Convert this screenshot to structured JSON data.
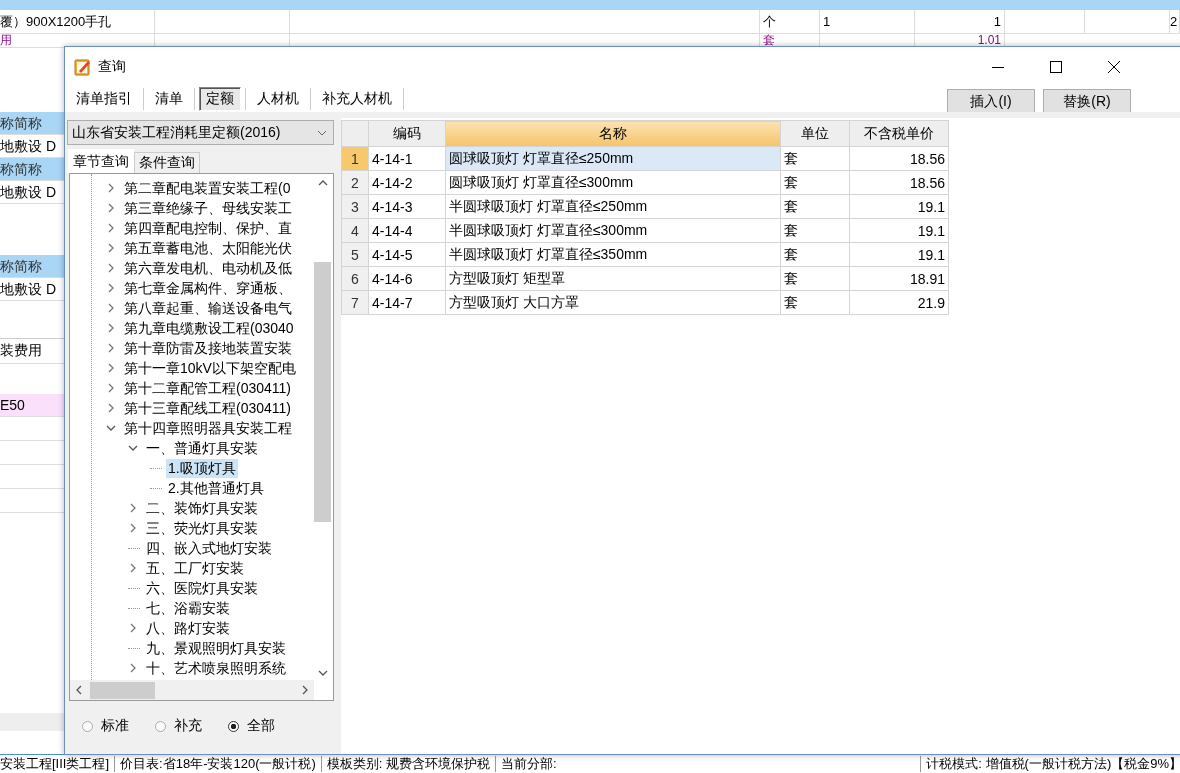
{
  "background": {
    "row_1": {
      "name": "覆）900X1200手孔",
      "unit": "个",
      "qty": "1",
      "value": "1",
      "column_9": "2"
    },
    "row_2": {
      "name": "用",
      "unit": "套",
      "value": "1.01"
    },
    "left_cells": [
      {
        "text": "称简称",
        "kind": "header"
      },
      {
        "text": "地敷设 D",
        "kind": "cell"
      },
      {
        "text": "称简称",
        "kind": "header"
      },
      {
        "text": "地敷设 D",
        "kind": "cell"
      },
      {
        "text": "称简称",
        "kind": "header"
      },
      {
        "text": "地敷设 D",
        "kind": "cell"
      },
      {
        "text": "装费用",
        "kind": "tab"
      },
      {
        "text": "E50",
        "kind": "highlight"
      }
    ]
  },
  "dialog": {
    "title": "查询",
    "tabs": [
      {
        "label": "清单指引",
        "selected": false
      },
      {
        "label": "清单",
        "selected": false
      },
      {
        "label": "定额",
        "selected": true
      },
      {
        "label": "人材机",
        "selected": false
      },
      {
        "label": "补充人材机",
        "selected": false
      }
    ],
    "buttons": [
      "插入(I)",
      "替换(R)"
    ],
    "library": "山东省安装工程消耗里定额(2016)",
    "search_tabs": [
      {
        "label": "章节查询",
        "selected": true
      },
      {
        "label": "条件查询",
        "selected": false
      }
    ],
    "tree": [
      {
        "label": "第二章配电装置安装工程(0",
        "expandable": true,
        "expanded": false,
        "selected": false
      },
      {
        "label": "第三章绝缘子、母线安装工",
        "expandable": true,
        "expanded": false,
        "selected": false
      },
      {
        "label": "第四章配电控制、保护、直",
        "expandable": true,
        "expanded": false,
        "selected": false
      },
      {
        "label": "第五章蓄电池、太阳能光伏",
        "expandable": true,
        "expanded": false,
        "selected": false
      },
      {
        "label": "第六章发电机、电动机及低",
        "expandable": true,
        "expanded": false,
        "selected": false
      },
      {
        "label": "第七章金属构件、穿通板、",
        "expandable": true,
        "expanded": false,
        "selected": false
      },
      {
        "label": "第八章起重、输送设备电气",
        "expandable": true,
        "expanded": false,
        "selected": false
      },
      {
        "label": "第九章电缆敷设工程(03040",
        "expandable": true,
        "expanded": false,
        "selected": false
      },
      {
        "label": "第十章防雷及接地装置安装",
        "expandable": true,
        "expanded": false,
        "selected": false
      },
      {
        "label": "第十一章10kV以下架空配电",
        "expandable": true,
        "expanded": false,
        "selected": false
      },
      {
        "label": "第十二章配管工程(030411)",
        "expandable": true,
        "expanded": false,
        "selected": false
      },
      {
        "label": "第十三章配线工程(030411)",
        "expandable": true,
        "expanded": false,
        "selected": false
      },
      {
        "label": "第十四章照明器具安装工程",
        "expandable": true,
        "expanded": true,
        "selected": false,
        "children": [
          {
            "label": "一、普通灯具安装",
            "expandable": true,
            "expanded": true,
            "selected": false,
            "children": [
              {
                "label": "1.吸顶灯具",
                "expandable": false,
                "selected": true
              },
              {
                "label": "2.其他普通灯具",
                "expandable": false,
                "selected": false
              }
            ]
          },
          {
            "label": "二、装饰灯具安装",
            "expandable": true,
            "expanded": false,
            "selected": false
          },
          {
            "label": "三、荧光灯具安装",
            "expandable": true,
            "expanded": false,
            "selected": false
          },
          {
            "label": "四、嵌入式地灯安装",
            "expandable": false,
            "selected": false
          },
          {
            "label": "五、工厂灯安装",
            "expandable": true,
            "expanded": false,
            "selected": false
          },
          {
            "label": "六、医院灯具安装",
            "expandable": false,
            "selected": false
          },
          {
            "label": "七、浴霸安装",
            "expandable": false,
            "selected": false
          },
          {
            "label": "八、路灯安装",
            "expandable": true,
            "expanded": false,
            "selected": false
          },
          {
            "label": "九、景观照明灯具安装",
            "expandable": false,
            "selected": false
          },
          {
            "label": "十、艺术喷泉照明系统",
            "expandable": true,
            "expanded": false,
            "selected": false
          }
        ]
      }
    ],
    "radios": [
      {
        "label": "标准",
        "selected": false
      },
      {
        "label": "补充",
        "selected": false
      },
      {
        "label": "全部",
        "selected": true
      }
    ],
    "table": {
      "columns": [
        {
          "label": "编码",
          "active": false
        },
        {
          "label": "名称",
          "active": true
        },
        {
          "label": "单位",
          "active": false
        },
        {
          "label": "不含税单价",
          "active": false
        }
      ],
      "rows": [
        {
          "number": "1",
          "code": "4-14-1",
          "name": "圆球吸顶灯 灯罩直径≤250mm",
          "unit": "套",
          "price": "18.56",
          "selected": true
        },
        {
          "number": "2",
          "code": "4-14-2",
          "name": "圆球吸顶灯 灯罩直径≤300mm",
          "unit": "套",
          "price": "18.56",
          "selected": false
        },
        {
          "number": "3",
          "code": "4-14-3",
          "name": "半圆球吸顶灯 灯罩直径≤250mm",
          "unit": "套",
          "price": "19.1",
          "selected": false
        },
        {
          "number": "4",
          "code": "4-14-4",
          "name": "半圆球吸顶灯 灯罩直径≤300mm",
          "unit": "套",
          "price": "19.1",
          "selected": false
        },
        {
          "number": "5",
          "code": "4-14-5",
          "name": "半圆球吸顶灯 灯罩直径≤350mm",
          "unit": "套",
          "price": "19.1",
          "selected": false
        },
        {
          "number": "6",
          "code": "4-14-6",
          "name": "方型吸顶灯 矩型罩",
          "unit": "套",
          "price": "18.91",
          "selected": false
        },
        {
          "number": "7",
          "code": "4-14-7",
          "name": "方型吸顶灯 大口方罩",
          "unit": "套",
          "price": "21.9",
          "selected": false
        }
      ]
    }
  },
  "status_bar": [
    "安装工程[III类工程]",
    "价目表:省18年-安装120(一般计税)",
    "模板类别: 规费含环境保护税",
    "当前分部:",
    "计税模式: 增值税(一般计税方法)【税金9%】"
  ]
}
